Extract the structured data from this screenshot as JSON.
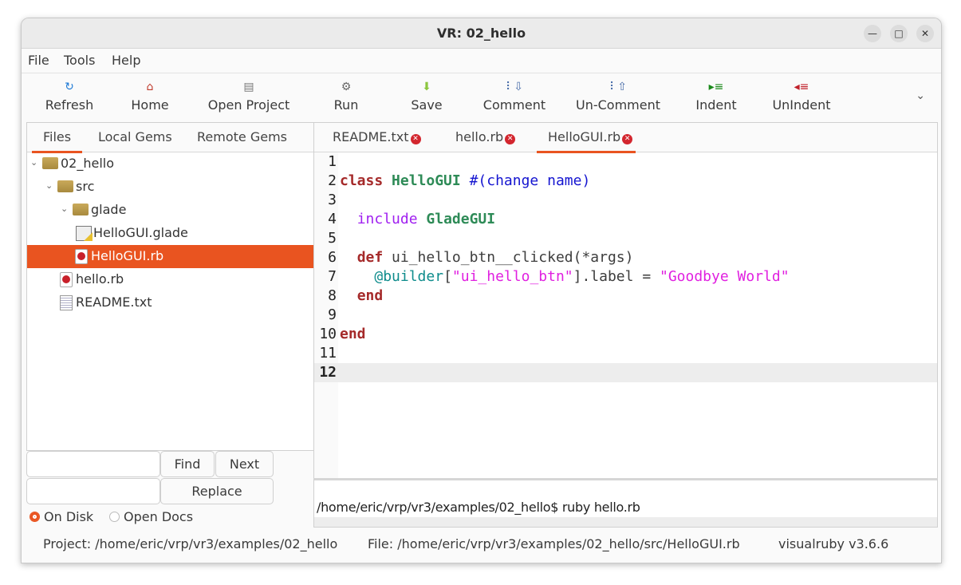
{
  "window": {
    "title": "VR: 02_hello",
    "controls": {
      "minimize": "—",
      "maximize": "□",
      "close": "✕"
    }
  },
  "menu": [
    "File",
    "Tools",
    "Help"
  ],
  "toolbar": {
    "items": [
      {
        "label": "Refresh",
        "icon": "refresh-icon",
        "glyph": "↻",
        "color": "#1f7ad6"
      },
      {
        "label": "Home",
        "icon": "home-icon",
        "glyph": "⌂",
        "color": "#c0392b"
      },
      {
        "label": "Open Project",
        "icon": "open-project-icon",
        "glyph": "▤",
        "color": "#777777"
      },
      {
        "label": "Run",
        "icon": "gears-icon",
        "glyph": "⚙",
        "color": "#666666"
      },
      {
        "label": "Save",
        "icon": "save-arrow-icon",
        "glyph": "⬇",
        "color": "#8cc63f"
      },
      {
        "label": "Comment",
        "icon": "comment-icon",
        "glyph": "⠇⇩",
        "color": "#4a6ea9"
      },
      {
        "label": "Un-Comment",
        "icon": "uncomment-icon",
        "glyph": "⠇⇧",
        "color": "#4a6ea9"
      },
      {
        "label": "Indent",
        "icon": "indent-icon",
        "glyph": "▸≡",
        "color": "#1a8a1a"
      },
      {
        "label": "UnIndent",
        "icon": "unindent-icon",
        "glyph": "◂≡",
        "color": "#c0202a"
      }
    ],
    "more": "⌄"
  },
  "left_tabs": [
    "Files",
    "Local Gems",
    "Remote Gems"
  ],
  "file_tree": [
    {
      "label": "02_hello",
      "type": "folder",
      "expanded": true,
      "depth": 0
    },
    {
      "label": "src",
      "type": "folder",
      "expanded": true,
      "depth": 1
    },
    {
      "label": "glade",
      "type": "folder",
      "expanded": true,
      "depth": 2
    },
    {
      "label": "HelloGUI.glade",
      "type": "glade",
      "depth": 3
    },
    {
      "label": "HelloGUI.rb",
      "type": "ruby",
      "depth": 2,
      "selected": true
    },
    {
      "label": "hello.rb",
      "type": "ruby",
      "depth": 1
    },
    {
      "label": "README.txt",
      "type": "text",
      "depth": 1
    }
  ],
  "find": {
    "find_value": "",
    "replace_value": "",
    "find_label": "Find",
    "next_label": "Next",
    "replace_label": "Replace",
    "radio_on_disk": "On Disk",
    "radio_open_docs": "Open Docs",
    "selected": "On Disk"
  },
  "editor_tabs": [
    {
      "label": "README.txt",
      "active": false
    },
    {
      "label": "hello.rb",
      "active": false
    },
    {
      "label": "HelloGUI.rb",
      "active": true
    }
  ],
  "code_lines": [
    {
      "n": "1",
      "tokens": []
    },
    {
      "n": "2",
      "tokens": [
        {
          "t": "class",
          "c": "kw"
        },
        {
          "t": " "
        },
        {
          "t": "HelloGUI",
          "c": "cls"
        },
        {
          "t": " "
        },
        {
          "t": "#(change name)",
          "c": "cmt"
        }
      ]
    },
    {
      "n": "3",
      "tokens": []
    },
    {
      "n": "4",
      "tokens": [
        {
          "t": "  "
        },
        {
          "t": "include",
          "c": "inc"
        },
        {
          "t": " "
        },
        {
          "t": "GladeGUI",
          "c": "cls"
        }
      ]
    },
    {
      "n": "5",
      "tokens": []
    },
    {
      "n": "6",
      "tokens": [
        {
          "t": "  "
        },
        {
          "t": "def",
          "c": "kw"
        },
        {
          "t": " ui_hello_btn__clicked(*args)"
        }
      ]
    },
    {
      "n": "7",
      "tokens": [
        {
          "t": "    "
        },
        {
          "t": "@builder",
          "c": "ivar"
        },
        {
          "t": "["
        },
        {
          "t": "\"ui_hello_btn\"",
          "c": "str"
        },
        {
          "t": "].label = "
        },
        {
          "t": "\"Goodbye World\"",
          "c": "str"
        }
      ]
    },
    {
      "n": "8",
      "tokens": [
        {
          "t": "  "
        },
        {
          "t": "end",
          "c": "kw"
        }
      ]
    },
    {
      "n": "9",
      "tokens": []
    },
    {
      "n": "10",
      "tokens": [
        {
          "t": "end",
          "c": "kw"
        }
      ]
    },
    {
      "n": "11",
      "tokens": []
    },
    {
      "n": "12",
      "tokens": [],
      "current": true
    }
  ],
  "terminal": {
    "text": "/home/eric/vrp/vr3/examples/02_hello$ ruby hello.rb"
  },
  "status": {
    "project": "Project:  /home/eric/vrp/vr3/examples/02_hello",
    "file": "File:  /home/eric/vrp/vr3/examples/02_hello/src/HelloGUI.rb",
    "version": "visualruby v3.6.6"
  },
  "colors": {
    "accent": "#e95420"
  }
}
